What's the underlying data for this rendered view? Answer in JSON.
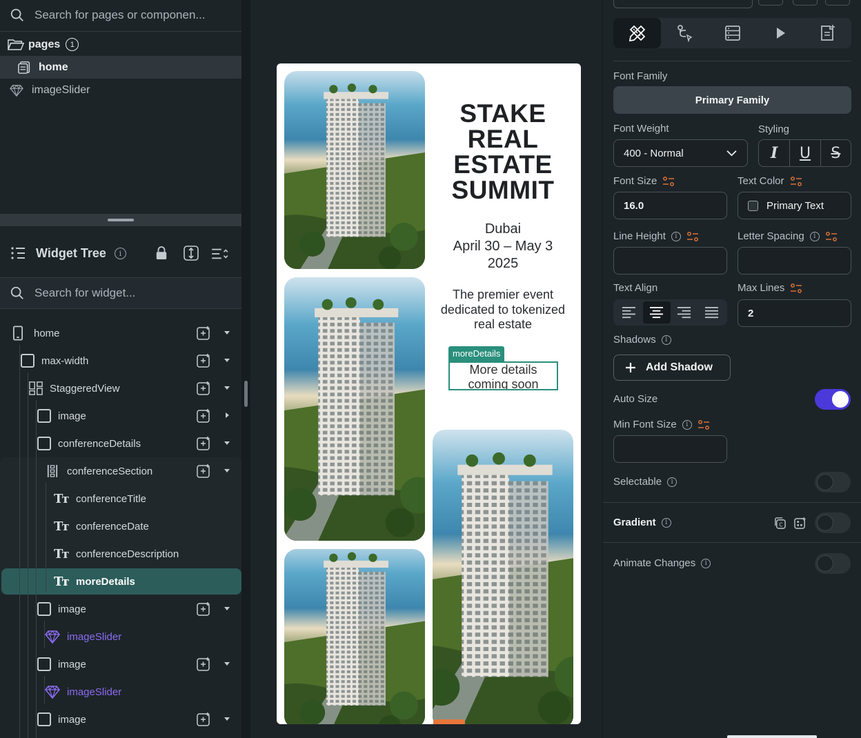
{
  "left": {
    "page_search_placeholder": "Search for pages or componen...",
    "pages_label": "pages",
    "pages_count": "1",
    "pages": [
      {
        "label": "home"
      },
      {
        "label": "imageSlider"
      }
    ],
    "widget_tree_title": "Widget Tree",
    "widget_search_placeholder": "Search for widget...",
    "tree": [
      {
        "label": "home"
      },
      {
        "label": "max-width"
      },
      {
        "label": "StaggeredView"
      },
      {
        "label": "image"
      },
      {
        "label": "conferenceDetails"
      },
      {
        "label": "conferenceSection"
      },
      {
        "label": "conferenceTitle"
      },
      {
        "label": "conferenceDate"
      },
      {
        "label": "conferenceDescription"
      },
      {
        "label": "moreDetails"
      },
      {
        "label": "image"
      },
      {
        "label": "imageSlider"
      },
      {
        "label": "image"
      },
      {
        "label": "imageSlider"
      },
      {
        "label": "image"
      }
    ]
  },
  "canvas": {
    "conference_title": "STAKE REAL ESTATE SUMMIT",
    "conference_date_line1": "Dubai",
    "conference_date_line2": "April 30 – May 3",
    "conference_date_line3": "2025",
    "conference_description": "The premier event dedicated to tokenized real estate",
    "more_details_tag": "moreDetails",
    "more_details_text": "More details coming soon"
  },
  "right": {
    "font_family_label": "Font Family",
    "font_family_value": "Primary Family",
    "font_weight_label": "Font Weight",
    "font_weight_value": "400 - Normal",
    "styling_label": "Styling",
    "font_size_label": "Font Size",
    "font_size_value": "16.0",
    "text_color_label": "Text Color",
    "text_color_value": "Primary Text",
    "line_height_label": "Line Height",
    "letter_spacing_label": "Letter Spacing",
    "text_align_label": "Text Align",
    "max_lines_label": "Max Lines",
    "max_lines_value": "2",
    "shadows_label": "Shadows",
    "add_shadow_label": "Add Shadow",
    "auto_size_label": "Auto Size",
    "auto_size_on": true,
    "min_font_size_label": "Min Font Size",
    "selectable_label": "Selectable",
    "gradient_label": "Gradient",
    "animate_changes_label": "Animate Changes"
  },
  "colors": {
    "accent_teal": "#2a8f7c",
    "toggle_on": "#4b39d9",
    "component_purple": "#8b6cf0"
  }
}
